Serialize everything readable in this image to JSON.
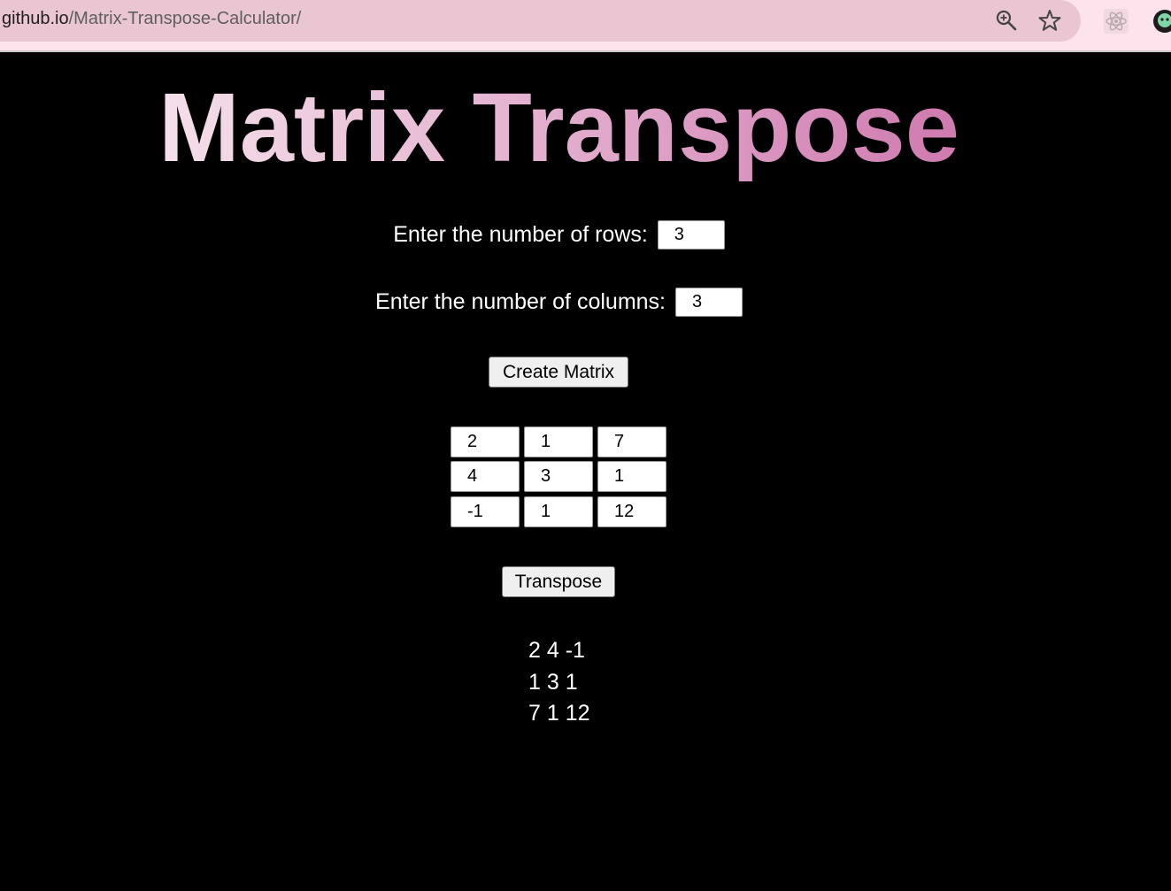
{
  "browser": {
    "url_host": "github.io",
    "url_path": "/Matrix-Transpose-Calculator/",
    "icons": [
      "zoom-icon",
      "bookmark-star-icon",
      "react-devtools-icon",
      "profile-avatar-icon"
    ]
  },
  "page": {
    "title": "Matrix Transpose",
    "rows_label": "Enter the number of rows:",
    "rows_value": "3",
    "columns_label": "Enter the number of columns:",
    "columns_value": "3",
    "create_button": "Create Matrix",
    "transpose_button": "Transpose"
  },
  "matrix": [
    [
      "2",
      "1",
      "7"
    ],
    [
      "4",
      "3",
      "1"
    ],
    [
      "-1",
      "1",
      "12"
    ]
  ],
  "result": [
    "2 4 -1",
    "1 3 1",
    "7 1 12"
  ],
  "colors": {
    "background": "#000000",
    "title_gradient_start": "#f6e3ec",
    "title_gradient_end": "#cf7ab0",
    "chrome_bg": "#fde4ec",
    "omnibox_bg": "#e9c6d1"
  }
}
